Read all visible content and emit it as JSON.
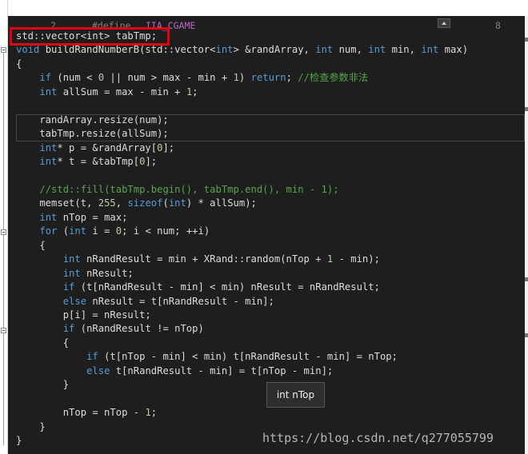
{
  "top": {
    "line_number": "2",
    "define_keyword": "#define",
    "define_macro": "IIA_CGAME",
    "right_number": "8"
  },
  "code": [
    [
      {
        "t": "std::vector<int> tabTmp;"
      }
    ],
    [
      {
        "t": "void",
        "c": "kw"
      },
      {
        "t": " buildRandNumberB(std::vector<"
      },
      {
        "t": "int",
        "c": "kw"
      },
      {
        "t": "> &randArray, "
      },
      {
        "t": "int",
        "c": "kw"
      },
      {
        "t": " num, "
      },
      {
        "t": "int",
        "c": "kw"
      },
      {
        "t": " min, "
      },
      {
        "t": "int",
        "c": "kw"
      },
      {
        "t": " max)"
      }
    ],
    [
      {
        "t": "{"
      }
    ],
    [
      {
        "t": "    "
      },
      {
        "t": "if",
        "c": "kw"
      },
      {
        "t": " (num < "
      },
      {
        "t": "0",
        "c": "num"
      },
      {
        "t": " || num > max - min + "
      },
      {
        "t": "1",
        "c": "num"
      },
      {
        "t": ") "
      },
      {
        "t": "return",
        "c": "kw"
      },
      {
        "t": "; "
      },
      {
        "t": "//检查参数非法",
        "c": "cm"
      }
    ],
    [
      {
        "t": "    "
      },
      {
        "t": "int",
        "c": "kw"
      },
      {
        "t": " allSum = max - min + "
      },
      {
        "t": "1",
        "c": "num"
      },
      {
        "t": ";"
      }
    ],
    [
      {
        "t": ""
      }
    ],
    [
      {
        "t": "    randArray.resize(num);"
      }
    ],
    [
      {
        "t": "    tabTmp.resize(allSum);"
      }
    ],
    [
      {
        "t": "    "
      },
      {
        "t": "int",
        "c": "kw"
      },
      {
        "t": "* p = &randArray["
      },
      {
        "t": "0",
        "c": "num"
      },
      {
        "t": "];"
      }
    ],
    [
      {
        "t": "    "
      },
      {
        "t": "int",
        "c": "kw"
      },
      {
        "t": "* t = &tabTmp["
      },
      {
        "t": "0",
        "c": "num"
      },
      {
        "t": "];"
      }
    ],
    [
      {
        "t": ""
      }
    ],
    [
      {
        "t": "    "
      },
      {
        "t": "//std::fill(tabTmp.begin(), tabTmp.end(), min - 1);",
        "c": "cm"
      }
    ],
    [
      {
        "t": "    memset(t, "
      },
      {
        "t": "255",
        "c": "num"
      },
      {
        "t": ", "
      },
      {
        "t": "sizeof",
        "c": "kw"
      },
      {
        "t": "("
      },
      {
        "t": "int",
        "c": "kw"
      },
      {
        "t": ") * allSum);"
      }
    ],
    [
      {
        "t": "    "
      },
      {
        "t": "int",
        "c": "kw"
      },
      {
        "t": " nTop = max;"
      }
    ],
    [
      {
        "t": "    "
      },
      {
        "t": "for",
        "c": "kw"
      },
      {
        "t": " ("
      },
      {
        "t": "int",
        "c": "kw"
      },
      {
        "t": " i = "
      },
      {
        "t": "0",
        "c": "num"
      },
      {
        "t": "; i < num; ++i)"
      }
    ],
    [
      {
        "t": "    {"
      }
    ],
    [
      {
        "t": "        "
      },
      {
        "t": "int",
        "c": "kw"
      },
      {
        "t": " nRandResult = min + XRand::random(nTop + "
      },
      {
        "t": "1",
        "c": "num"
      },
      {
        "t": " - min);"
      }
    ],
    [
      {
        "t": "        "
      },
      {
        "t": "int",
        "c": "kw"
      },
      {
        "t": " nResult;"
      }
    ],
    [
      {
        "t": "        "
      },
      {
        "t": "if",
        "c": "kw"
      },
      {
        "t": " (t[nRandResult - min] < min) nResult = nRandResult;"
      }
    ],
    [
      {
        "t": "        "
      },
      {
        "t": "else",
        "c": "kw"
      },
      {
        "t": " nResult = t[nRandResult - min];"
      }
    ],
    [
      {
        "t": "        p[i] = nResult;"
      }
    ],
    [
      {
        "t": "        "
      },
      {
        "t": "if",
        "c": "kw"
      },
      {
        "t": " (nRandResult != nTop)"
      }
    ],
    [
      {
        "t": "        {"
      }
    ],
    [
      {
        "t": "            "
      },
      {
        "t": "if",
        "c": "kw"
      },
      {
        "t": " (t[nTop - min] < min) t[nRandResult - min] = nTop;"
      }
    ],
    [
      {
        "t": "            "
      },
      {
        "t": "else",
        "c": "kw"
      },
      {
        "t": " t[nRandResult - min] = t[nTop - min];"
      }
    ],
    [
      {
        "t": "        }"
      }
    ],
    [
      {
        "t": ""
      }
    ],
    [
      {
        "t": "        nTop = nTop - "
      },
      {
        "t": "1",
        "c": "num"
      },
      {
        "t": ";"
      }
    ],
    [
      {
        "t": "    }"
      }
    ],
    [
      {
        "t": "}"
      }
    ]
  ],
  "tooltip": "int nTop",
  "watermark": "https://blog.csdn.net/q277055799",
  "colors": {
    "background": "#1e1e1e",
    "keyword": "#569cd6",
    "comment": "#57a64a",
    "number": "#b5cea8",
    "text": "#dcdcdc",
    "highlight_box": "#e0000f"
  }
}
